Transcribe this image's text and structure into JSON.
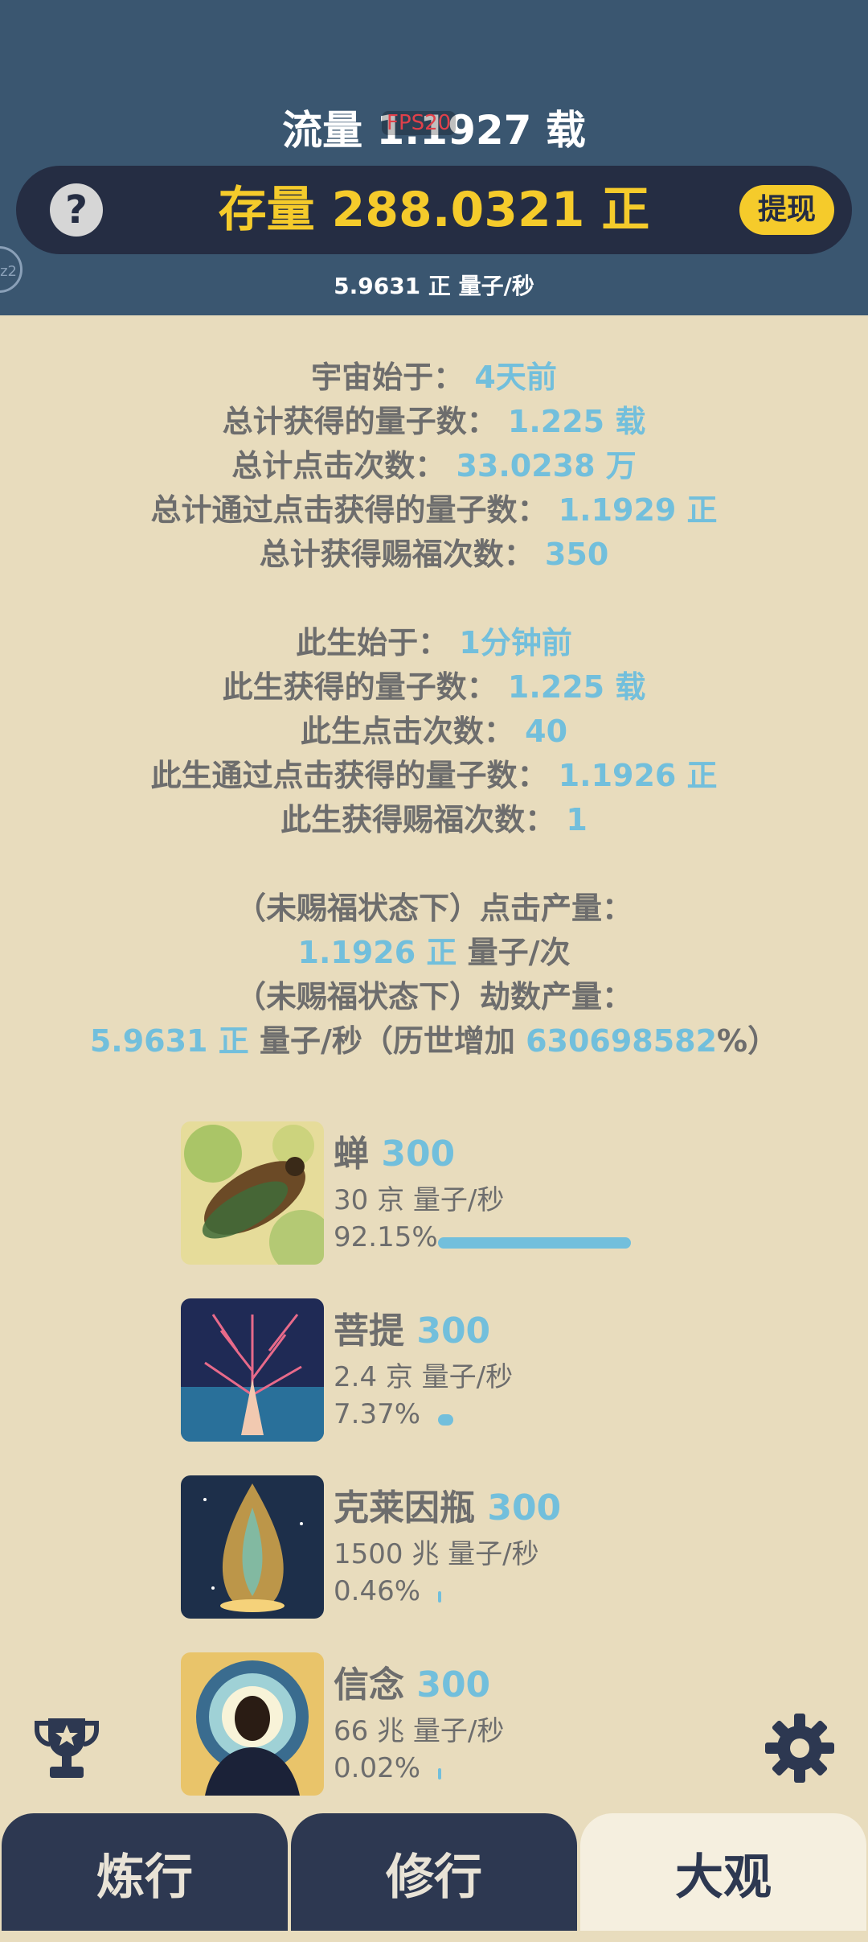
{
  "header": {
    "flow_label": "流量 1.1927 载",
    "fps": "FPS20",
    "stock_label": "存量 288.0321 正",
    "withdraw_label": "提现",
    "help_icon": "question-icon",
    "rate": "5.9631 正  量子/秒",
    "side_badge": "z2"
  },
  "stats": {
    "universe_start": {
      "label": "宇宙始于：",
      "value": "4天前"
    },
    "total_quanta": {
      "label": "总计获得的量子数：",
      "value": "1.225 载"
    },
    "total_clicks": {
      "label": "总计点击次数：",
      "value": "33.0238 万"
    },
    "total_click_quanta": {
      "label": "总计通过点击获得的量子数：",
      "value": "1.1929 正"
    },
    "total_blessings": {
      "label": "总计获得赐福次数：",
      "value": "350"
    },
    "life_start": {
      "label": "此生始于：",
      "value": "1分钟前"
    },
    "life_quanta": {
      "label": "此生获得的量子数：",
      "value": "1.225 载"
    },
    "life_clicks": {
      "label": "此生点击次数：",
      "value": "40"
    },
    "life_click_quanta": {
      "label": "此生通过点击获得的量子数：",
      "value": "1.1926 正"
    },
    "life_blessings": {
      "label": "此生获得赐福次数：",
      "value": "1"
    },
    "click_output_label": "（未赐福状态下）点击产量：",
    "click_output_value": "1.1926 正",
    "click_output_unit": " 量子/次",
    "kalpa_output_label": "（未赐福状态下）劫数产量：",
    "kalpa_output_value": "5.9631 正",
    "kalpa_output_unit": " 量子/秒（历世增加 ",
    "kalpa_output_pct": "630698582",
    "kalpa_output_suffix": "%）"
  },
  "producers": [
    {
      "name": "蝉",
      "count": "300",
      "rate": "30 京 量子/秒",
      "percent": "92.15%",
      "share": 0.9215,
      "icon": "cicada-image"
    },
    {
      "name": "菩提",
      "count": "300",
      "rate": "2.4 京 量子/秒",
      "percent": "7.37%",
      "share": 0.0737,
      "icon": "bodhi-tree-image"
    },
    {
      "name": "克莱因瓶",
      "count": "300",
      "rate": "1500 兆 量子/秒",
      "percent": "0.46%",
      "share": 0.0046,
      "icon": "klein-bottle-image"
    },
    {
      "name": "信念",
      "count": "300",
      "rate": "66 兆 量子/秒",
      "percent": "0.02%",
      "share": 0.0002,
      "icon": "faith-person-image"
    }
  ],
  "tabs": [
    {
      "label": "炼行",
      "active": false
    },
    {
      "label": "修行",
      "active": false
    },
    {
      "label": "大观",
      "active": true
    }
  ],
  "colors": {
    "header_bg": "#3a5670",
    "stock_bar_bg": "#252d43",
    "accent_yellow": "#f5cb2b",
    "value_blue": "#72bfdc",
    "page_bg": "#e8dcbd"
  },
  "icons": {
    "trophy": "trophy-icon",
    "settings": "gear-icon"
  }
}
